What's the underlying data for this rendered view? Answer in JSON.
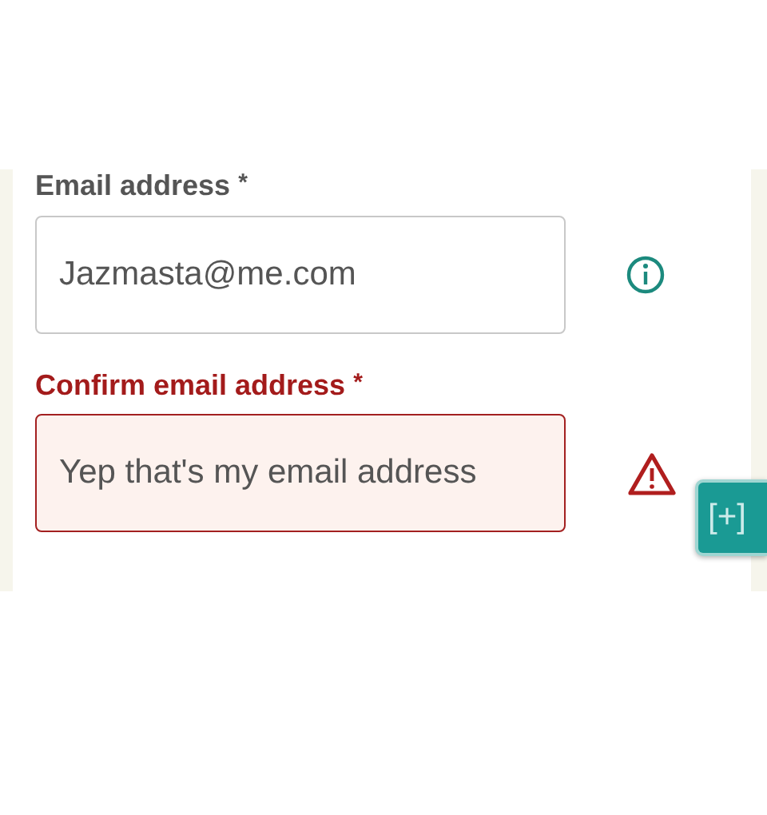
{
  "fields": [
    {
      "label": "Email address",
      "required_mark": "*",
      "value": "Jazmasta@me.com",
      "error": false
    },
    {
      "label": "Confirm email address",
      "required_mark": "*",
      "value": "Yep that's my email address",
      "error": true
    }
  ],
  "float_button": {
    "label": "[+]"
  }
}
